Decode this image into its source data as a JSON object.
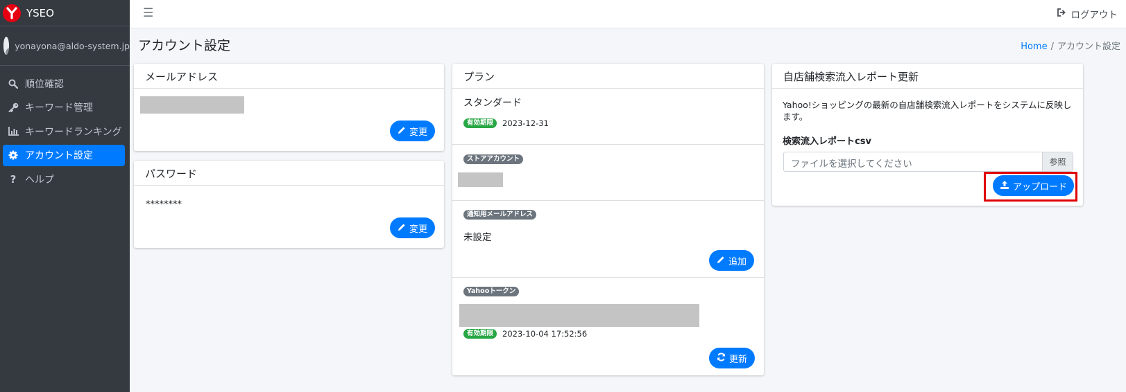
{
  "app": {
    "brand": "YSEO",
    "user_email": "yonayona@aldo-system.jp"
  },
  "sidebar": {
    "items": [
      {
        "label": "順位確認",
        "icon": "search-icon",
        "active": false
      },
      {
        "label": "キーワード管理",
        "icon": "key-icon",
        "active": false
      },
      {
        "label": "キーワードランキング",
        "icon": "bar-chart-icon",
        "active": false
      },
      {
        "label": "アカウント設定",
        "icon": "gear-icon",
        "active": true
      },
      {
        "label": "ヘルプ",
        "icon": "question-icon",
        "active": false
      }
    ]
  },
  "topbar": {
    "logout_label": "ログアウト"
  },
  "page": {
    "title": "アカウント設定",
    "breadcrumb": {
      "home": "Home",
      "current": "アカウント設定"
    }
  },
  "email_card": {
    "title": "メールアドレス",
    "button": "変更"
  },
  "password_card": {
    "title": "パスワード",
    "value": "********",
    "button": "変更"
  },
  "plan_card": {
    "title": "プラン",
    "plan_name": "スタンダード",
    "expiry_badge": "有効期限",
    "expiry_date": "2023-12-31",
    "store_badge": "ストアアカウント",
    "notify_badge": "通知用メールアドレス",
    "notify_value": "未設定",
    "add_button": "追加",
    "token_badge": "Yahooトークン",
    "token_expiry_badge": "有効期限",
    "token_expiry": "2023-10-04 17:52:56",
    "refresh_button": "更新"
  },
  "report_card": {
    "title": "自店舗検索流入レポート更新",
    "description": "Yahoo!ショッピングの最新の自店舗検索流入レポートをシステムに反映します。",
    "field_label": "検索流入レポートcsv",
    "file_placeholder": "ファイルを選択してください",
    "browse_label": "参照",
    "upload_button": "アップロード"
  },
  "colors": {
    "primary": "#007bff",
    "sidebar": "#343a40",
    "success": "#28a745",
    "highlight": "#e00000"
  }
}
